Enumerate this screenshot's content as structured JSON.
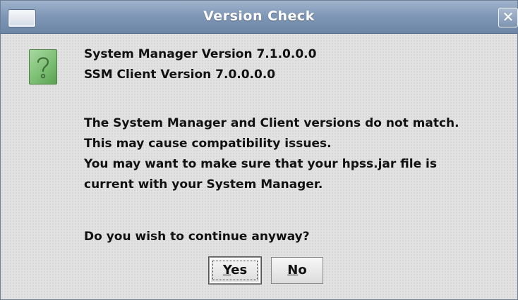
{
  "dialog": {
    "title": "Version Check",
    "close_glyph": "✕"
  },
  "icon": {
    "name": "question-icon"
  },
  "message": {
    "versions": [
      "System Manager Version 7.1.0.0.0",
      "SSM Client Version 7.0.0.0.0"
    ],
    "warning": [
      "The System Manager and Client versions do not match.",
      "This may cause compatibility issues.",
      "You may want to make sure that your hpss.jar file is",
      "current with your System Manager."
    ],
    "question": "Do you wish to continue anyway?"
  },
  "buttons": {
    "yes": {
      "mnemonic": "Y",
      "rest": "es"
    },
    "no": {
      "mnemonic": "N",
      "rest": "o"
    }
  },
  "colors": {
    "titlebar": "#7f97b6",
    "dialog_bg": "#e2e2e2",
    "icon_bg": "#7dbf74"
  }
}
